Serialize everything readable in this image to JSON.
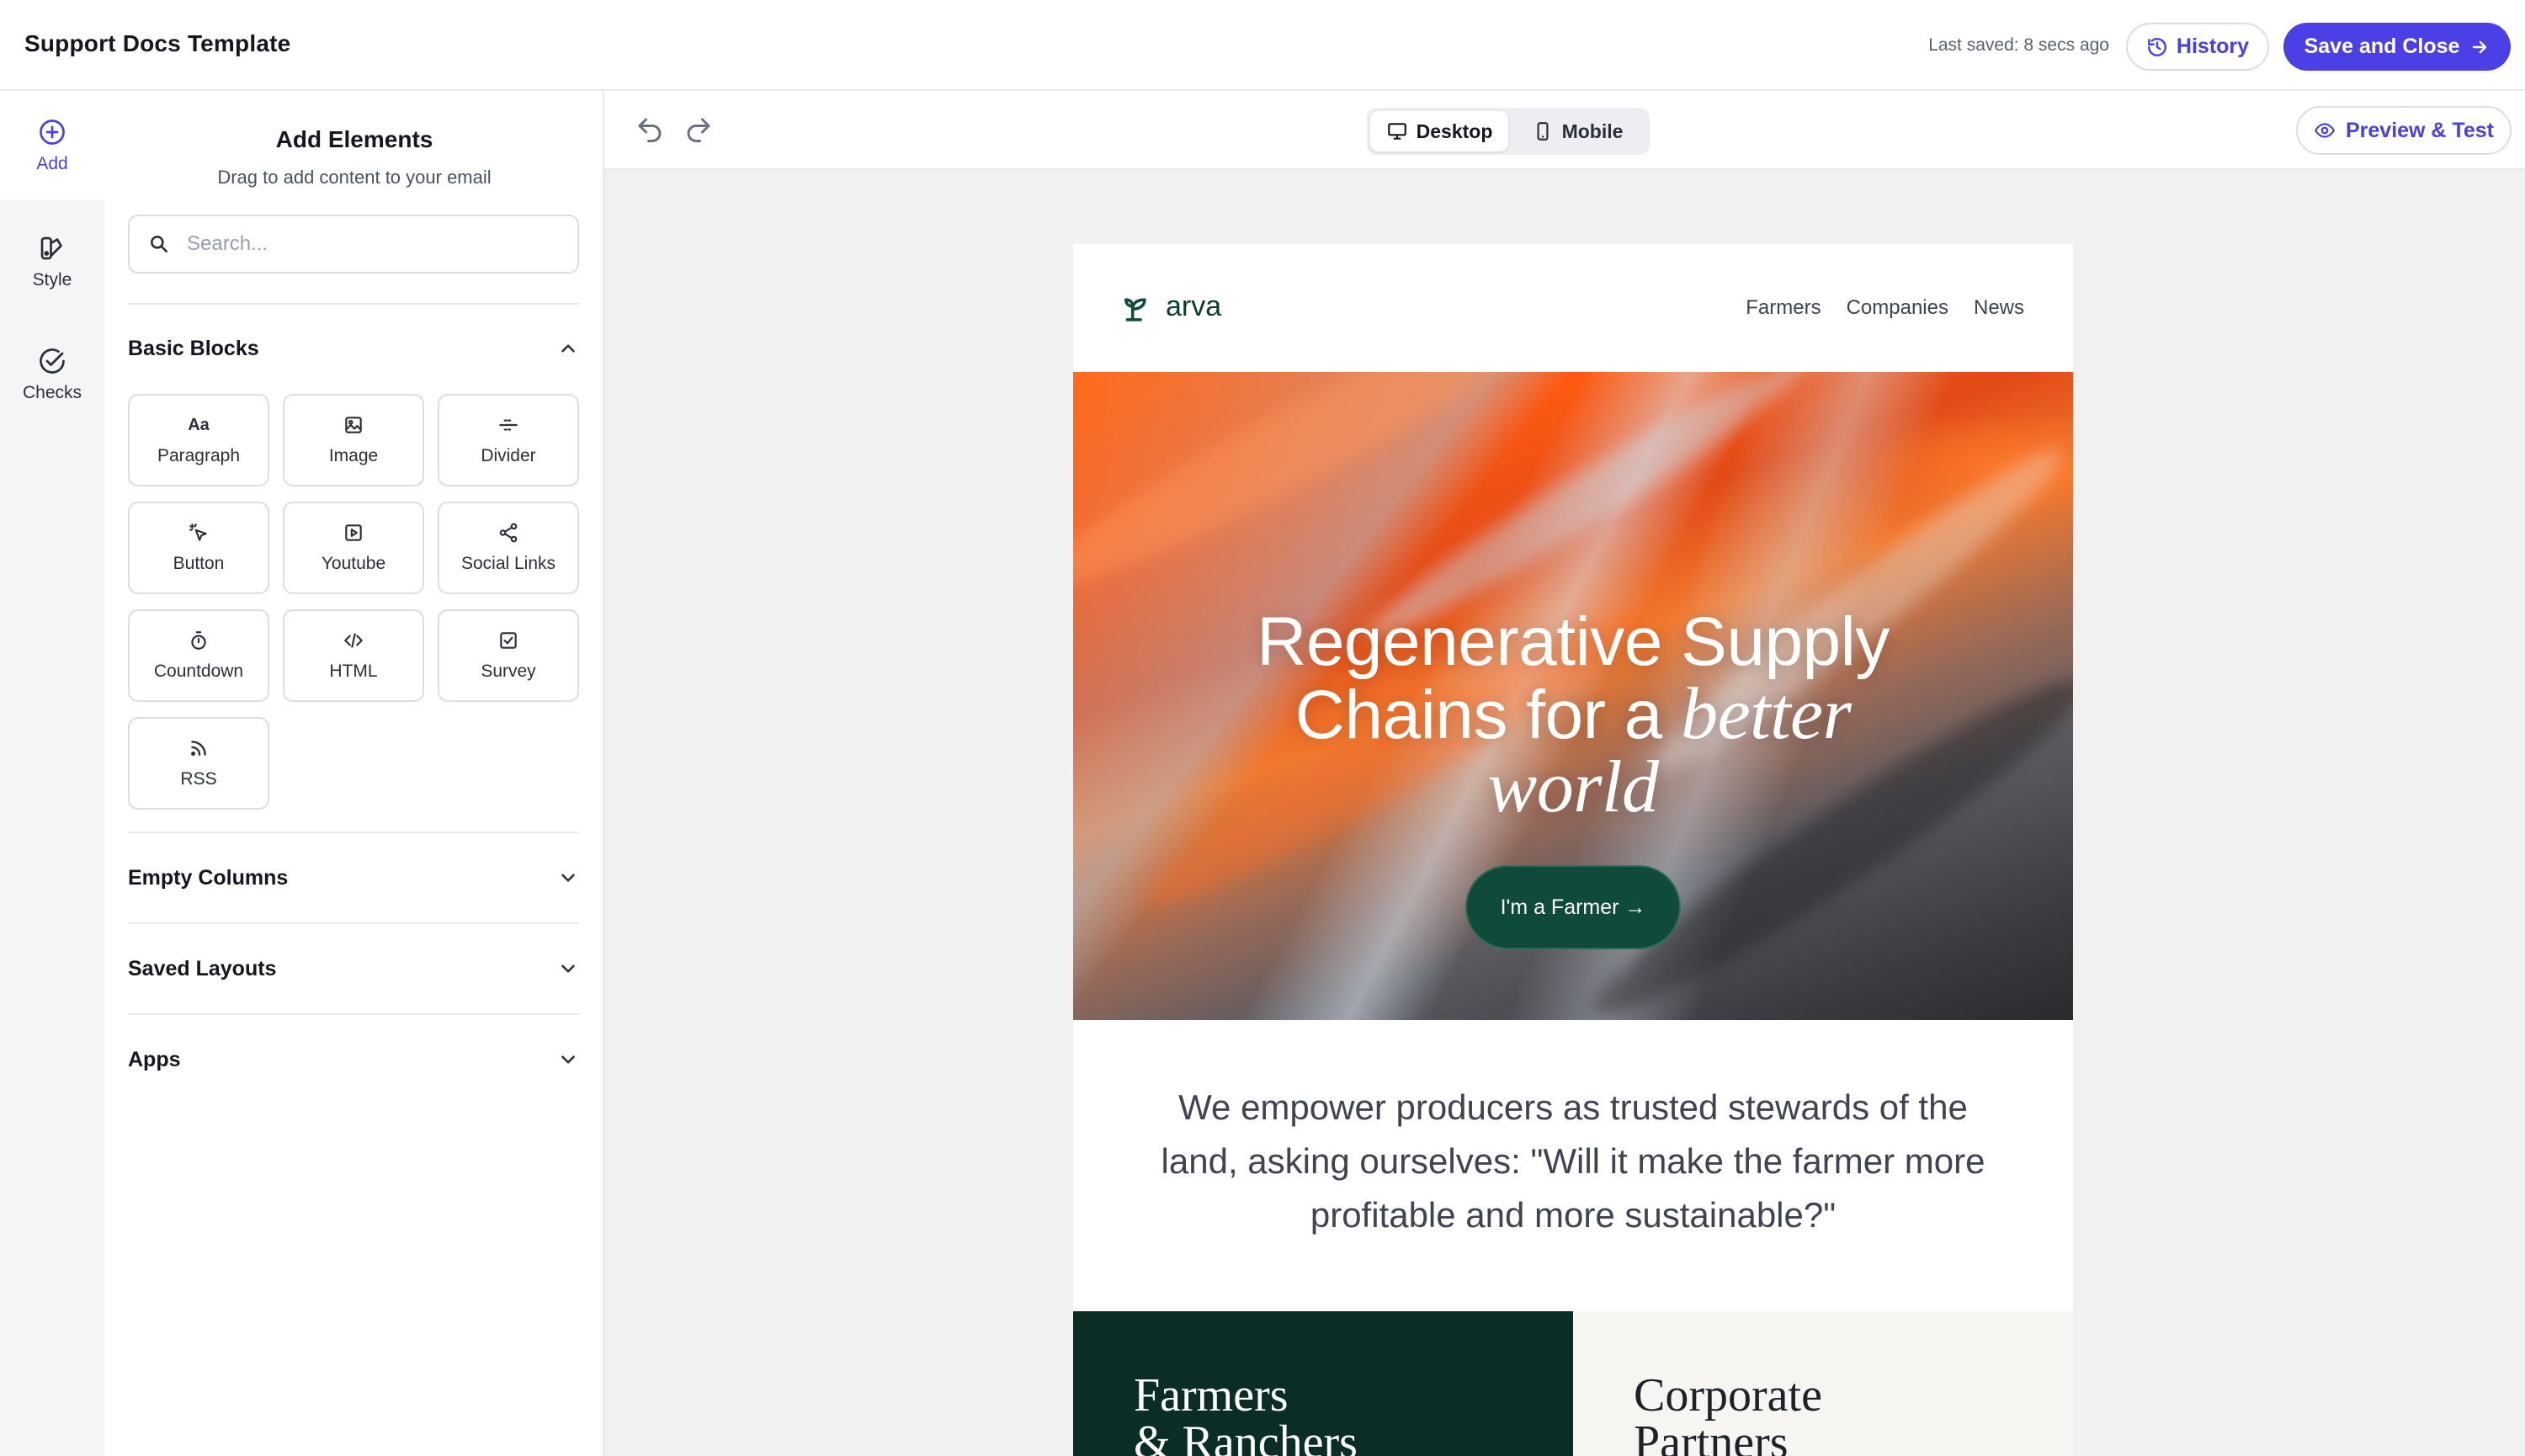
{
  "topbar": {
    "title": "Support Docs Template",
    "last_saved": "Last saved: 8 secs ago",
    "history_label": "History",
    "save_label": "Save and Close"
  },
  "rail": {
    "items": [
      {
        "label": "Add",
        "icon": "plus-circle-icon",
        "active": true
      },
      {
        "label": "Style",
        "icon": "palette-icon",
        "active": false
      },
      {
        "label": "Checks",
        "icon": "check-circle-icon",
        "active": false
      }
    ]
  },
  "panel": {
    "title": "Add Elements",
    "subtitle": "Drag to add content to your email",
    "search_placeholder": "Search...",
    "basic_blocks": {
      "label": "Basic Blocks",
      "expanded": true,
      "tiles": [
        {
          "label": "Paragraph",
          "icon": "text-aa-icon"
        },
        {
          "label": "Image",
          "icon": "image-icon"
        },
        {
          "label": "Divider",
          "icon": "divider-icon"
        },
        {
          "label": "Button",
          "icon": "cursor-click-icon"
        },
        {
          "label": "Youtube",
          "icon": "play-icon"
        },
        {
          "label": "Social Links",
          "icon": "share-icon"
        },
        {
          "label": "Countdown",
          "icon": "timer-icon"
        },
        {
          "label": "HTML",
          "icon": "code-icon"
        },
        {
          "label": "Survey",
          "icon": "checkbox-icon"
        },
        {
          "label": "RSS",
          "icon": "rss-icon"
        }
      ]
    },
    "sections": [
      {
        "label": "Empty Columns",
        "expanded": false
      },
      {
        "label": "Saved Layouts",
        "expanded": false
      },
      {
        "label": "Apps",
        "expanded": false
      }
    ]
  },
  "toolbar": {
    "device_desktop": "Desktop",
    "device_mobile": "Mobile",
    "active_device": "Desktop",
    "preview_label": "Preview & Test"
  },
  "email": {
    "logo_text": "arva",
    "nav": [
      "Farmers",
      "Companies",
      "News"
    ],
    "hero_line1": "Regenerative Supply",
    "hero_line2": "Chains for a ",
    "hero_italic_1": "better",
    "hero_italic_2": "world",
    "hero_button": "I'm a Farmer →",
    "mission": "We empower producers as trusted stewards of the land, asking ourselves: \"Will it make the farmer more profitable and more sustainable?\"",
    "col_left_line1": "Farmers",
    "col_left_line2": "& Ranchers",
    "col_right_line1": "Corporate",
    "col_right_line2": "Partners"
  },
  "colors": {
    "accent": "#4b40e5",
    "brand_green": "#0f4a3b",
    "dark_green": "#0a2e25",
    "canvas_bg": "#f1f1f2"
  }
}
